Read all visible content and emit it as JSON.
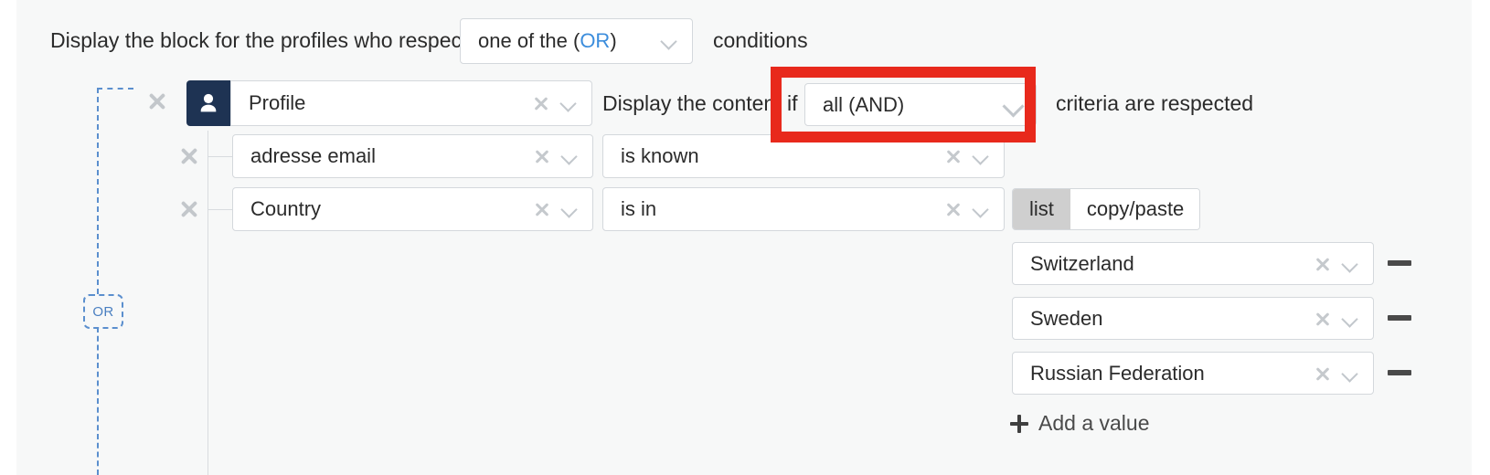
{
  "header": {
    "lead_text": "Display the block for the profiles who respect",
    "operator_select": {
      "prefix": "one of the (",
      "accent": "OR",
      "suffix": ")"
    },
    "trail_text": "conditions"
  },
  "group": {
    "connector_label": "OR"
  },
  "profile_block": {
    "icon": "person-icon",
    "dimension_field": "Profile",
    "mid_text": "Display the content if",
    "logic_select": "all (AND)",
    "end_text": "criteria are respected"
  },
  "conditions": [
    {
      "field": "adresse email",
      "operator": "is known",
      "has_values": false
    },
    {
      "field": "Country",
      "operator": "is in",
      "has_values": true
    }
  ],
  "value_editor": {
    "mode_tabs": [
      {
        "label": "list",
        "active": true
      },
      {
        "label": "copy/paste",
        "active": false
      }
    ],
    "values": [
      "Switzerland",
      "Sweden",
      "Russian Federation"
    ],
    "add_label": "Add a value"
  },
  "annotation": {
    "color": "#e8291c",
    "target": "logic-select"
  },
  "icons": {
    "clear": "close-x-icon",
    "dropdown": "chevron-down-icon",
    "remove_row": "remove-x-icon",
    "remove_value": "minus-icon",
    "add": "plus-icon"
  }
}
